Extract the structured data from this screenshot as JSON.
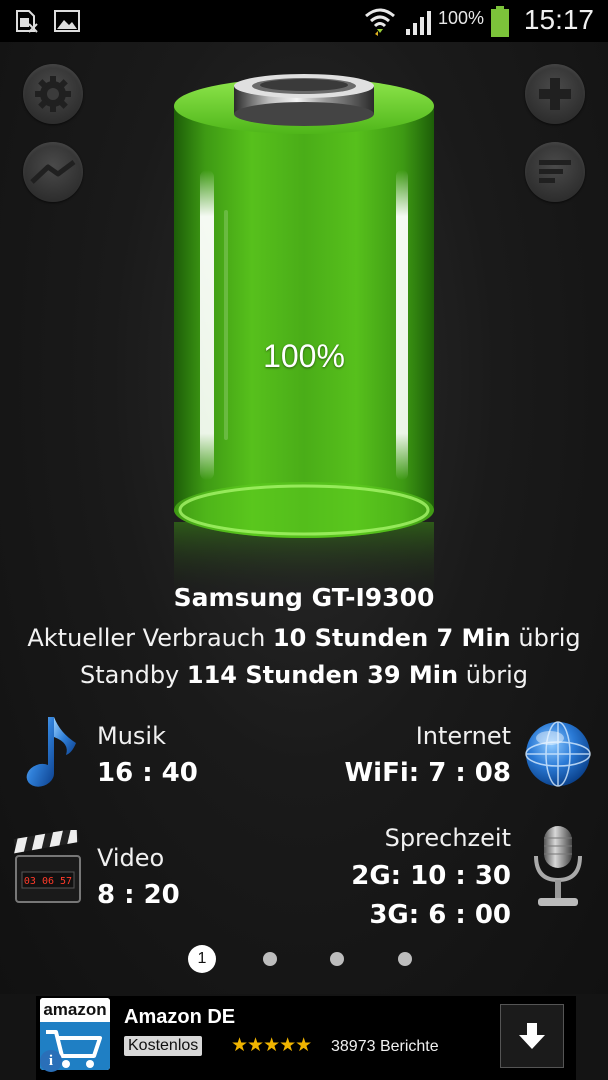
{
  "status_bar": {
    "battery_percent": "100%",
    "time": "15:17",
    "colors": {
      "battery": "#7cc43a"
    },
    "icons": [
      "sim-card-missing-icon",
      "gallery-icon",
      "wifi-icon",
      "signal-icon",
      "battery-icon"
    ]
  },
  "battery": {
    "level_text": "100%",
    "level_fraction": 1.0,
    "colors": {
      "fill": "#5fd11e",
      "rim": "#9cf05a"
    }
  },
  "device": {
    "name": "Samsung GT-I9300",
    "usage_prefix": "Aktueller Verbrauch",
    "usage_value": "10 Stunden 7 Min",
    "usage_suffix": "übrig",
    "standby_prefix": "Standby",
    "standby_value": "114 Stunden 39 Min",
    "standby_suffix": "übrig"
  },
  "stats": {
    "music": {
      "label": "Musik",
      "value": "16 : 40",
      "icon": "music-note-icon"
    },
    "internet": {
      "label": "Internet",
      "value": "WiFi: 7 : 08",
      "icon": "globe-icon"
    },
    "video": {
      "label": "Video",
      "value": "8 : 20",
      "icon": "clapperboard-icon",
      "clock_text": "03 06 57"
    },
    "talk": {
      "label": "Sprechzeit",
      "value_2g": "2G: 10 : 30",
      "value_3g": "3G: 6 : 00",
      "icon": "microphone-icon"
    }
  },
  "pager": {
    "active_label": "1",
    "total": 4,
    "active_index": 0
  },
  "ad": {
    "brand": "amazon",
    "title": "Amazon DE",
    "badge": "Kostenlos",
    "stars": "★★★★★",
    "rating_fraction": 0.9,
    "reviews": "38973 Berichte",
    "info_glyph": "i",
    "colors": {
      "logo_blue": "#1f7fc4",
      "star": "#f0b400"
    }
  }
}
